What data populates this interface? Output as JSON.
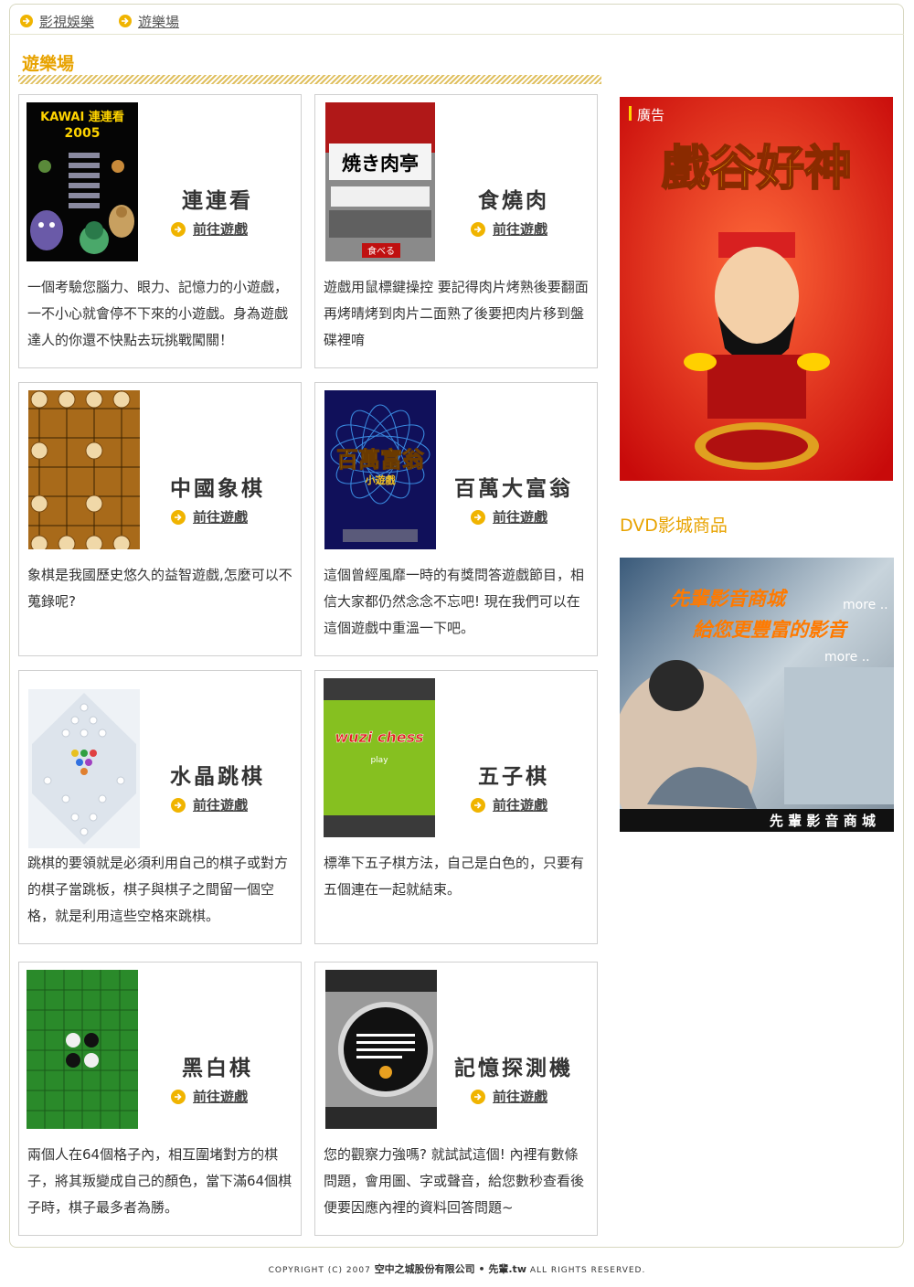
{
  "breadcrumb": {
    "items": [
      "影視娛樂",
      "遊樂場"
    ]
  },
  "main": {
    "section_title": "遊樂場"
  },
  "games": [
    {
      "name": "連連看",
      "link": "前往遊戲",
      "desc": "一個考驗您腦力、眼力、記憶力的小遊戲，一不小心就會停不下來的小遊戲。身為遊戲達人的你還不快點去玩挑戰闖關！",
      "thumb_title": "KAWAI 連連看",
      "thumb_year": "2005"
    },
    {
      "name": "食燒肉",
      "link": "前往遊戲",
      "desc": "遊戲用鼠標鍵操控 要記得肉片烤熟後要翻面再烤晴烤到肉片二面熟了後要把肉片移到盤碟裡唷",
      "thumb_title": "焼き肉亭",
      "thumb_button": "食べる"
    },
    {
      "name": "中國象棋",
      "link": "前往遊戲",
      "desc": "象棋是我國歷史悠久的益智遊戲,怎麼可以不蒐錄呢?"
    },
    {
      "name": "百萬大富翁",
      "link": "前往遊戲",
      "desc": "這個曾經風靡一時的有獎問答遊戲節目，相信大家都仍然念念不忘吧! 現在我們可以在這個遊戲中重溫一下吧。",
      "thumb_title": "百萬富翁",
      "thumb_sub": "小遊戲"
    },
    {
      "name": "水晶跳棋",
      "link": "前往遊戲",
      "desc": "跳棋的要領就是必須利用自己的棋子或對方的棋子當跳板，棋子與棋子之間留一個空格，就是利用這些空格來跳棋。"
    },
    {
      "name": "五子棋",
      "link": "前往遊戲",
      "desc": "標準下五子棋方法，自己是白色的，只要有五個連在一起就結束。",
      "thumb_title": "wuzi chess",
      "thumb_play": "play"
    },
    {
      "name": "黑白棋",
      "link": "前往遊戲",
      "desc": "兩個人在64個格子內，相互圍堵對方的棋子，將其叛變成自己的顏色，當下滿64個棋子時，棋子最多者為勝。"
    },
    {
      "name": "記憶探測機",
      "link": "前往遊戲",
      "desc": "您的觀察力強嗎? 就試試這個! 內裡有數條問題，會用圖、字或聲音，給您數秒查看後便要因應內裡的資料回答問題~"
    }
  ],
  "sidebar": {
    "ad_label": "廣告",
    "ad_title": "戲谷好神",
    "dvd_title": "DVD影城商品",
    "dvd_banner_line1": "先輩影音商城",
    "dvd_banner_line2": "給您更豐富的影音",
    "dvd_more": "more ..",
    "dvd_footer": "先 輩 影 音 商 城"
  },
  "footer": {
    "prefix": "COPYRIGHT (C) 2007 ",
    "company": "空中之城股份有限公司 • 先輩.tw",
    "suffix": " ALL RIGHTS RESERVED."
  },
  "colors": {
    "accent": "#e8a300",
    "arrow": "#f0b400"
  }
}
